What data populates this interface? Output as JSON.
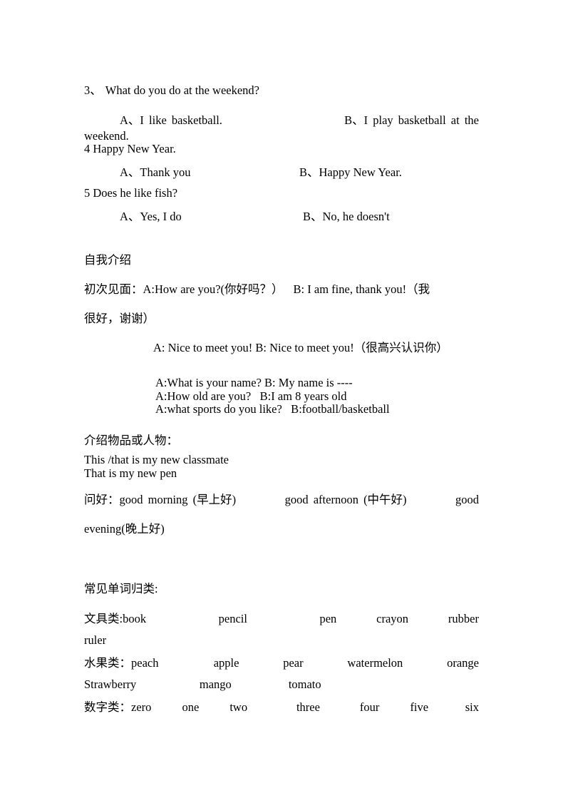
{
  "document": {
    "language": "zh-CN + en",
    "background_color": "#ffffff",
    "text_color": "#000000"
  },
  "quiz": {
    "q3": {
      "number": "3、",
      "text": "What do you do at the weekend?",
      "option_a": "A、I like basketball.",
      "option_b": "B、I play basketball at the",
      "option_b_cont": "weekend."
    },
    "q4": {
      "text": "4 Happy New Year.",
      "option_a": "A、Thank you",
      "option_b": "B、Happy New Year."
    },
    "q5": {
      "text": "5 Does he like fish?",
      "option_a": "A、Yes, I do",
      "option_b": "B、No, he doesn't"
    }
  },
  "self_intro": {
    "heading": "自我介绍",
    "first_meeting_label": "初次见面：",
    "first_meeting_a": "A:How are you?(你好吗？）",
    "first_meeting_b": "B: I am fine, thank you!（我",
    "first_meeting_cont": "很好，谢谢）",
    "nice_to_meet": "A: Nice to meet you!   B: Nice to meet you!（很高兴认识你）",
    "dialogue": [
      "A:What is your name? B: My name is ----",
      "A:How old are you?   B:I am 8 years old",
      "A:what sports do you like?   B:football/basketball"
    ]
  },
  "introduce_things": {
    "heading": "介绍物品或人物：",
    "lines": [
      "This /that is my new classmate",
      "That is my new pen"
    ]
  },
  "greetings": {
    "label": "问好：",
    "items": [
      "good morning (早上好)",
      "good afternoon (中午好)",
      "good"
    ],
    "continuation": "evening(晚上好)"
  },
  "word_groups": {
    "heading": "常见单词归类:",
    "groups": [
      {
        "label": "文具类: ",
        "words": [
          "book",
          "pencil",
          "pen",
          "crayon",
          "rubber"
        ],
        "overflow": [
          "ruler"
        ]
      },
      {
        "label": "水果类：",
        "words": [
          "peach",
          "apple",
          "pear",
          "watermelon",
          "orange"
        ],
        "overflow": [
          "Strawberry",
          "mango",
          "tomato"
        ]
      },
      {
        "label": "数字类：",
        "words": [
          "zero",
          "one",
          "two",
          "three",
          "four",
          "five",
          "six"
        ],
        "overflow": []
      }
    ]
  }
}
